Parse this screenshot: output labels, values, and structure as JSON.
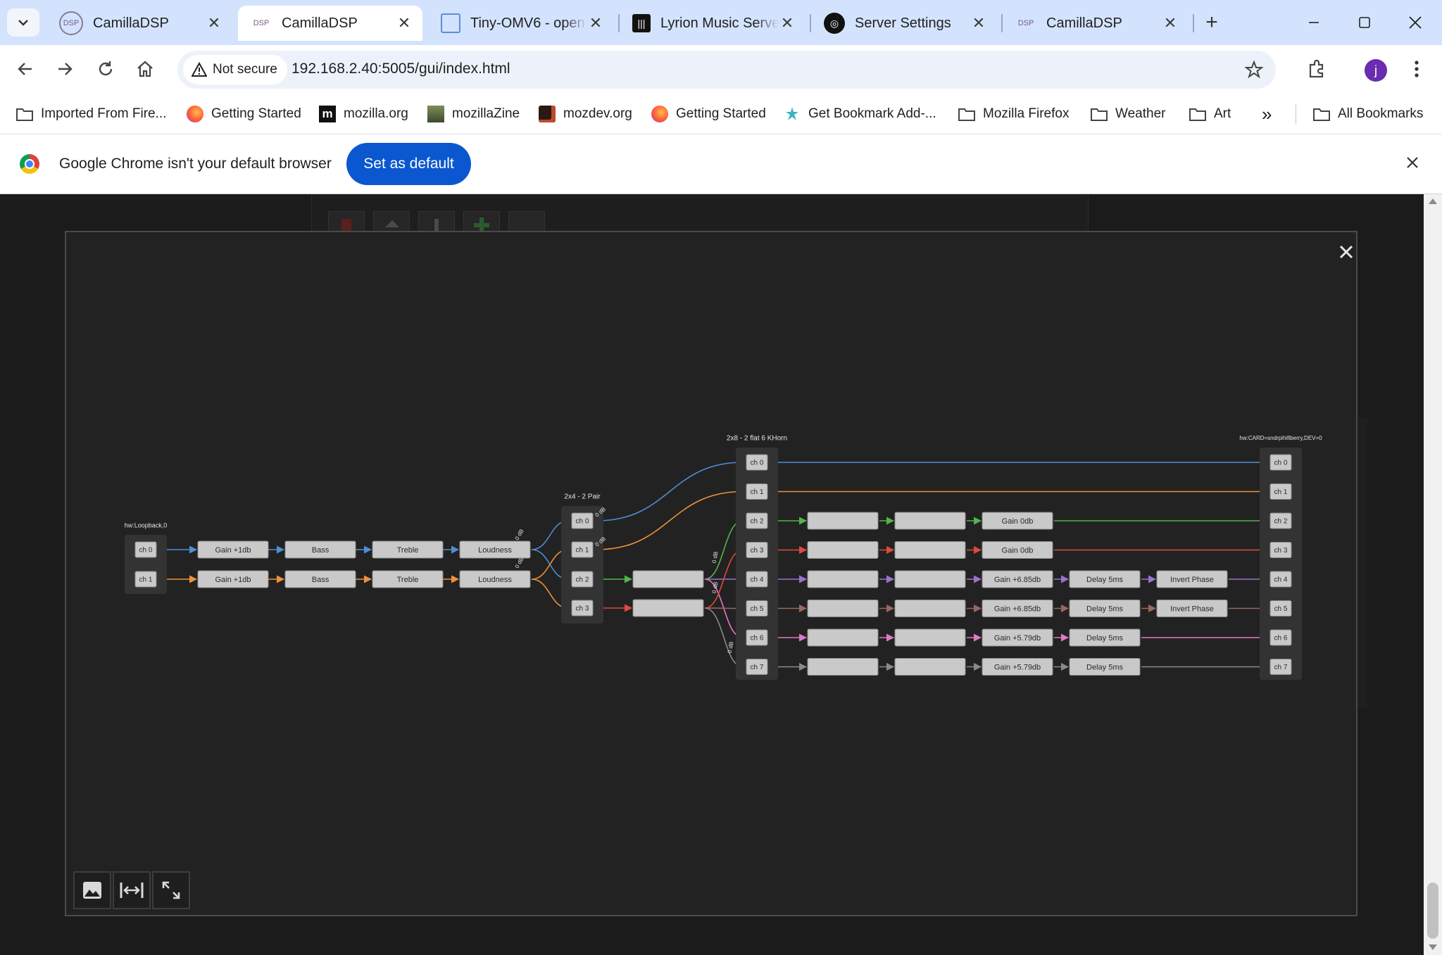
{
  "tabs": [
    {
      "label": "CamillaDSP",
      "icon": "camilladsp-icon",
      "active": false
    },
    {
      "label": "CamillaDSP",
      "icon": "camilladsp-icon",
      "active": true
    },
    {
      "label": "Tiny-OMV6 - open",
      "icon": "document-icon",
      "active": false
    },
    {
      "label": "Lyrion Music Server",
      "icon": "lyrion-icon",
      "active": false
    },
    {
      "label": "Server Settings",
      "icon": "server-icon",
      "active": false
    },
    {
      "label": "CamillaDSP",
      "icon": "camilladsp-icon",
      "active": false
    }
  ],
  "toolbar": {
    "security_label": "Not secure",
    "url": "192.168.2.40:5005/gui/index.html",
    "profile_initial": "j"
  },
  "bookmarks": [
    {
      "label": "Imported From Fire...",
      "icon": "folder-icon"
    },
    {
      "label": "Getting Started",
      "icon": "firefox-icon"
    },
    {
      "label": "mozilla.org",
      "icon": "mozilla-icon"
    },
    {
      "label": "mozillaZine",
      "icon": "mozillazine-icon"
    },
    {
      "label": "mozdev.org",
      "icon": "mozdev-icon"
    },
    {
      "label": "Getting Started",
      "icon": "firefox-icon"
    },
    {
      "label": "Get Bookmark Add-...",
      "icon": "addon-icon"
    },
    {
      "label": "Mozilla Firefox",
      "icon": "folder-icon"
    },
    {
      "label": "Weather",
      "icon": "folder-icon"
    },
    {
      "label": "Art",
      "icon": "folder-icon"
    }
  ],
  "bookmarks_overflow": "»",
  "all_bookmarks_label": "All Bookmarks",
  "infobar": {
    "message": "Google Chrome isn't your default browser",
    "button_label": "Set as default"
  },
  "colors": {
    "ch0": "#4e8fd6",
    "ch1": "#f0913a",
    "ch2": "#4fb64a",
    "ch3": "#e0483f",
    "ch4": "#9c72cf",
    "ch5": "#9a675e",
    "ch6": "#e178c5",
    "ch7": "#8a8a8a",
    "node_fill": "#c9c9c9",
    "group_fill": "#333333",
    "accent_blue": "#0b57d0"
  },
  "pipeline": {
    "capture_label": "hw:Loopback,0",
    "capture_channels": [
      "ch 0",
      "ch 1"
    ],
    "chain_filters": [
      "Gain +1db",
      "Bass",
      "Treble",
      "Loudness"
    ],
    "mixer1_label": "2x4 - 2 Pair",
    "mixer1_channels": [
      "ch 0",
      "ch 1",
      "ch 2",
      "ch 3"
    ],
    "mixer1_link_gain": "0 dB",
    "mixer2_label": "2x8 - 2 flat 6 KHorn",
    "mixer2_channels": [
      "ch 0",
      "ch 1",
      "ch 2",
      "ch 3",
      "ch 4",
      "ch 5",
      "ch 6",
      "ch 7"
    ],
    "mixer2_link_gain": "0 dB",
    "playback_label": "hw:CARD=sndrpihifiberry,DEV=0",
    "playback_channels": [
      "ch 0",
      "ch 1",
      "ch 2",
      "ch 3",
      "ch 4",
      "ch 5",
      "ch 6",
      "ch 7"
    ],
    "gain_labels": {
      "ch2": "Gain 0db",
      "ch3": "Gain 0db",
      "ch4": "Gain +6.85db",
      "ch5": "Gain +6.85db",
      "ch6": "Gain +5.79db",
      "ch7": "Gain +5.79db"
    },
    "delay_label": "Delay 5ms",
    "invert_label": "Invert Phase"
  }
}
